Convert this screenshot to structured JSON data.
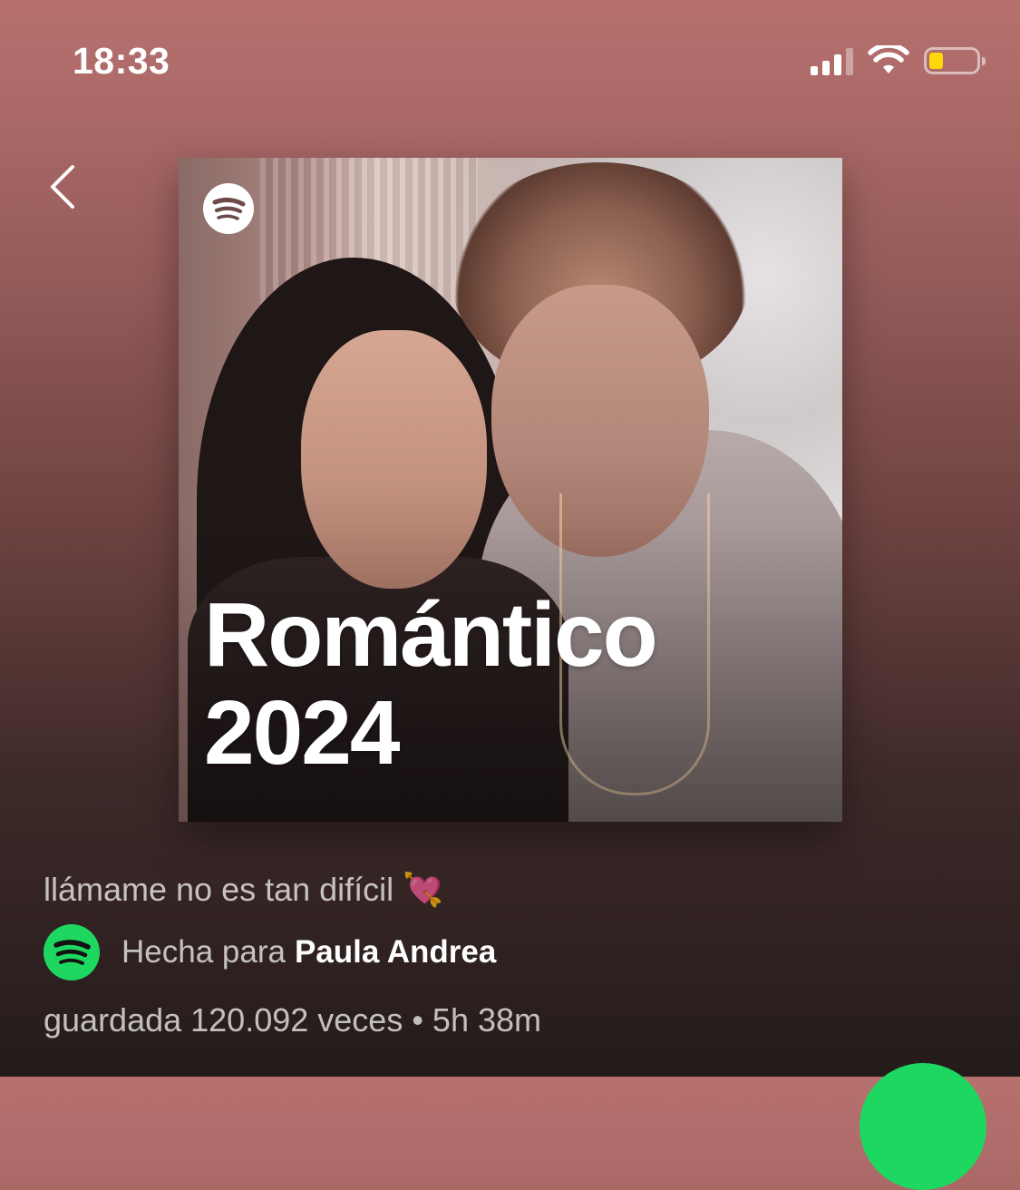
{
  "status_bar": {
    "time": "18:33",
    "icons": [
      "cellular-signal-icon",
      "wifi-icon",
      "battery-icon"
    ],
    "battery_color": "#ffd60a"
  },
  "nav": {
    "back_icon": "chevron-left-icon"
  },
  "cover": {
    "logo_icon": "spotify-logo-icon",
    "title_line1": "Romántico",
    "title_line2": "2024"
  },
  "playlist": {
    "description": "llámame no es tan difícil 💘",
    "made_for_prefix": "Hecha para",
    "made_for_name": "Paula Andrea",
    "stats": "guardada 120.092 veces • 5h 38m",
    "owner_logo_icon": "spotify-logo-icon"
  },
  "colors": {
    "spotify_green": "#1ed760",
    "gradient_top": "#b7716f",
    "gradient_bottom": "#241b1b"
  }
}
